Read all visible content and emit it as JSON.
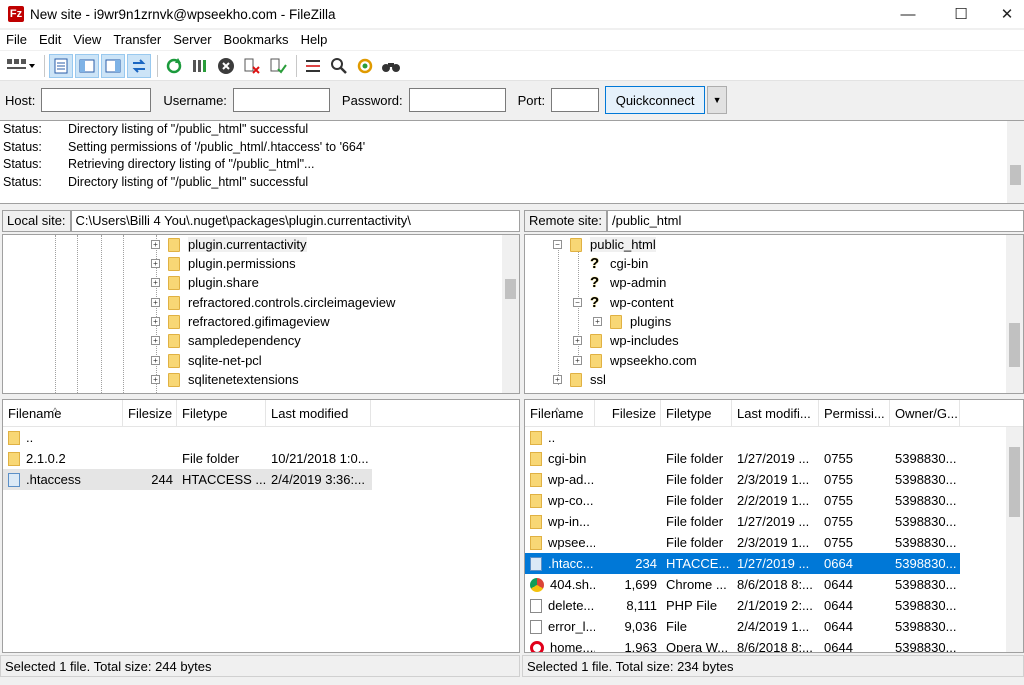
{
  "window": {
    "title": "New site - i9wr9n1zrnvk@wpseekho.com - FileZilla",
    "app_icon": "Fz",
    "min_glyph": "—",
    "max_glyph": "☐",
    "close_glyph": "✕"
  },
  "menu": [
    "File",
    "Edit",
    "View",
    "Transfer",
    "Server",
    "Bookmarks",
    "Help"
  ],
  "toolbar": {
    "icons": [
      "site-manager-icon",
      "message-log-icon",
      "local-tree-icon",
      "remote-tree-icon",
      "transfer-queue-icon",
      "refresh-icon",
      "process-queue-icon",
      "cancel-icon",
      "disconnect-icon",
      "reconnect-icon",
      "filter-icon",
      "search-remote-icon",
      "sync-browse-icon",
      "find-icon"
    ]
  },
  "quickconnect": {
    "host_label": "Host:",
    "host_value": "",
    "username_label": "Username:",
    "username_value": "",
    "password_label": "Password:",
    "password_value": "",
    "port_label": "Port:",
    "port_value": "",
    "button_label": "Quickconnect",
    "dropdown_glyph": "▼"
  },
  "log": [
    {
      "type": "Status:",
      "msg": "Directory listing of \"/public_html\" successful"
    },
    {
      "type": "Status:",
      "msg": "Setting permissions of '/public_html/.htaccess' to '664'"
    },
    {
      "type": "Status:",
      "msg": "Retrieving directory listing of \"/public_html\"..."
    },
    {
      "type": "Status:",
      "msg": "Directory listing of \"/public_html\" successful"
    }
  ],
  "local": {
    "site_label": "Local site:",
    "site_path": "C:\\Users\\Billi 4 You\\.nuget\\packages\\plugin.currentactivity\\",
    "tree": [
      {
        "label": "plugin.currentactivity",
        "exp": "+",
        "hl": true
      },
      {
        "label": "plugin.permissions",
        "exp": "+"
      },
      {
        "label": "plugin.share",
        "exp": "+"
      },
      {
        "label": "refractored.controls.circleimageview",
        "exp": "+"
      },
      {
        "label": "refractored.gifimageview",
        "exp": "+"
      },
      {
        "label": "sampledependency",
        "exp": "+"
      },
      {
        "label": "sqlite-net-pcl",
        "exp": "+"
      },
      {
        "label": "sqlitenetextensions",
        "exp": "+"
      }
    ],
    "columns": [
      "Filename",
      "Filesize",
      "Filetype",
      "Last modified"
    ],
    "files": [
      {
        "name": "..",
        "size": "",
        "type": "",
        "modified": "",
        "icon": "folder"
      },
      {
        "name": "2.1.0.2",
        "size": "",
        "type": "File folder",
        "modified": "10/21/2018 1:0...",
        "icon": "folder"
      },
      {
        "name": ".htaccess",
        "size": "244",
        "type": "HTACCESS ...",
        "modified": "2/4/2019 3:36:...",
        "icon": "htaccess",
        "inactive": true
      }
    ],
    "status": "Selected 1 file. Total size: 244 bytes"
  },
  "remote": {
    "site_label": "Remote site:",
    "site_path": "/public_html",
    "tree": [
      {
        "label": "public_html",
        "exp": "−",
        "icon": "folder",
        "hl": true
      },
      {
        "label": "cgi-bin",
        "exp": "",
        "icon": "q"
      },
      {
        "label": "wp-admin",
        "exp": "",
        "icon": "q"
      },
      {
        "label": "wp-content",
        "exp": "−",
        "icon": "q"
      },
      {
        "label": "plugins",
        "exp": "+",
        "icon": "folder"
      },
      {
        "label": "wp-includes",
        "exp": "+",
        "icon": "folder"
      },
      {
        "label": "wpseekho.com",
        "exp": "+",
        "icon": "folder"
      },
      {
        "label": "ssl",
        "exp": "+",
        "icon": "folder"
      }
    ],
    "columns": [
      "Filename",
      "Filesize",
      "Filetype",
      "Last modifi...",
      "Permissi...",
      "Owner/G..."
    ],
    "files": [
      {
        "name": "..",
        "size": "",
        "type": "",
        "modified": "",
        "perm": "",
        "owner": "",
        "icon": "folder"
      },
      {
        "name": "cgi-bin",
        "size": "",
        "type": "File folder",
        "modified": "1/27/2019 ...",
        "perm": "0755",
        "owner": "5398830...",
        "icon": "folder"
      },
      {
        "name": "wp-ad...",
        "size": "",
        "type": "File folder",
        "modified": "2/3/2019 1...",
        "perm": "0755",
        "owner": "5398830...",
        "icon": "folder"
      },
      {
        "name": "wp-co...",
        "size": "",
        "type": "File folder",
        "modified": "2/2/2019 1...",
        "perm": "0755",
        "owner": "5398830...",
        "icon": "folder"
      },
      {
        "name": "wp-in...",
        "size": "",
        "type": "File folder",
        "modified": "1/27/2019 ...",
        "perm": "0755",
        "owner": "5398830...",
        "icon": "folder"
      },
      {
        "name": "wpsee...",
        "size": "",
        "type": "File folder",
        "modified": "2/3/2019 1...",
        "perm": "0755",
        "owner": "5398830...",
        "icon": "folder"
      },
      {
        "name": ".htacc...",
        "size": "234",
        "type": "HTACCE...",
        "modified": "1/27/2019 ...",
        "perm": "0664",
        "owner": "5398830...",
        "icon": "htaccess",
        "selected": true
      },
      {
        "name": "404.sh...",
        "size": "1,699",
        "type": "Chrome ...",
        "modified": "8/6/2018 8:...",
        "perm": "0644",
        "owner": "5398830...",
        "icon": "chrome"
      },
      {
        "name": "delete...",
        "size": "8,111",
        "type": "PHP File",
        "modified": "2/1/2019 2:...",
        "perm": "0644",
        "owner": "5398830...",
        "icon": "file"
      },
      {
        "name": "error_l...",
        "size": "9,036",
        "type": "File",
        "modified": "2/4/2019 1...",
        "perm": "0644",
        "owner": "5398830...",
        "icon": "file"
      },
      {
        "name": "home....",
        "size": "1,963",
        "type": "Opera W...",
        "modified": "8/6/2018 8:...",
        "perm": "0644",
        "owner": "5398830...",
        "icon": "opera"
      }
    ],
    "status": "Selected 1 file. Total size: 234 bytes"
  }
}
